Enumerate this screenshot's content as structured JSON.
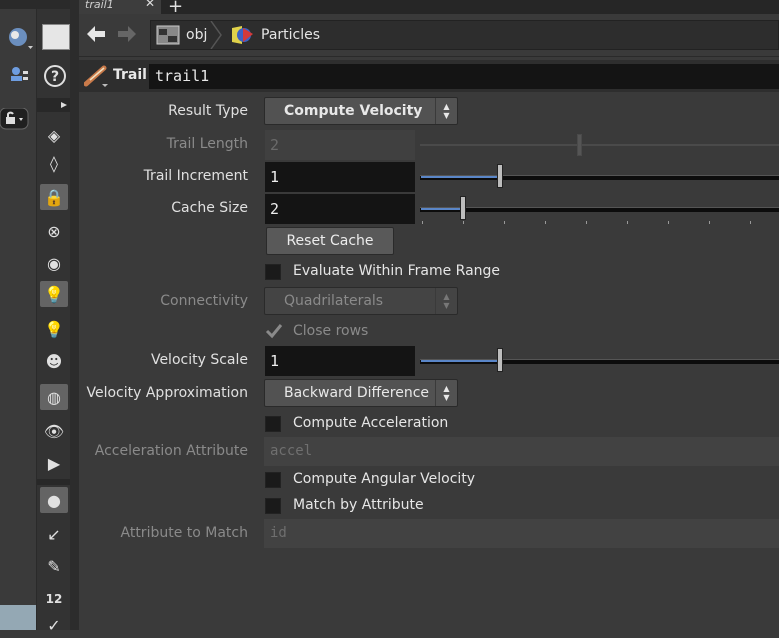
{
  "tab": {
    "title": "trail1",
    "close": "✕",
    "add": "+"
  },
  "path": {
    "back": "🡄",
    "forward": "🡆",
    "root": "obj",
    "node": "Particles"
  },
  "node": {
    "type": "Trail",
    "name": "trail1"
  },
  "params": {
    "result_type": {
      "label": "Result Type",
      "value": "Compute Velocity"
    },
    "trail_length": {
      "label": "Trail Length",
      "value": "2"
    },
    "trail_increment": {
      "label": "Trail Increment",
      "value": "1"
    },
    "cache_size": {
      "label": "Cache Size",
      "value": "2"
    },
    "reset_cache": {
      "label": "Reset Cache"
    },
    "evaluate_range": {
      "label": "Evaluate Within Frame Range",
      "checked": false
    },
    "connectivity": {
      "label": "Connectivity",
      "value": "Quadrilaterals"
    },
    "close_rows": {
      "label": "Close rows",
      "checked": true
    },
    "velocity_scale": {
      "label": "Velocity Scale",
      "value": "1"
    },
    "velocity_approx": {
      "label": "Velocity Approximation",
      "value": "Backward Difference"
    },
    "compute_accel": {
      "label": "Compute Acceleration",
      "checked": false
    },
    "accel_attr": {
      "label": "Acceleration Attribute",
      "value": "accel"
    },
    "compute_angular": {
      "label": "Compute Angular Velocity",
      "checked": false
    },
    "match_by_attr": {
      "label": "Match by Attribute",
      "checked": false
    },
    "attr_to_match": {
      "label": "Attribute to Match",
      "value": "id"
    }
  },
  "shelf": {
    "badge": "12"
  },
  "colors": {
    "slider_fill": "#5a86c8",
    "field_bg": "#141414",
    "panel_bg": "#3a3a3a"
  }
}
